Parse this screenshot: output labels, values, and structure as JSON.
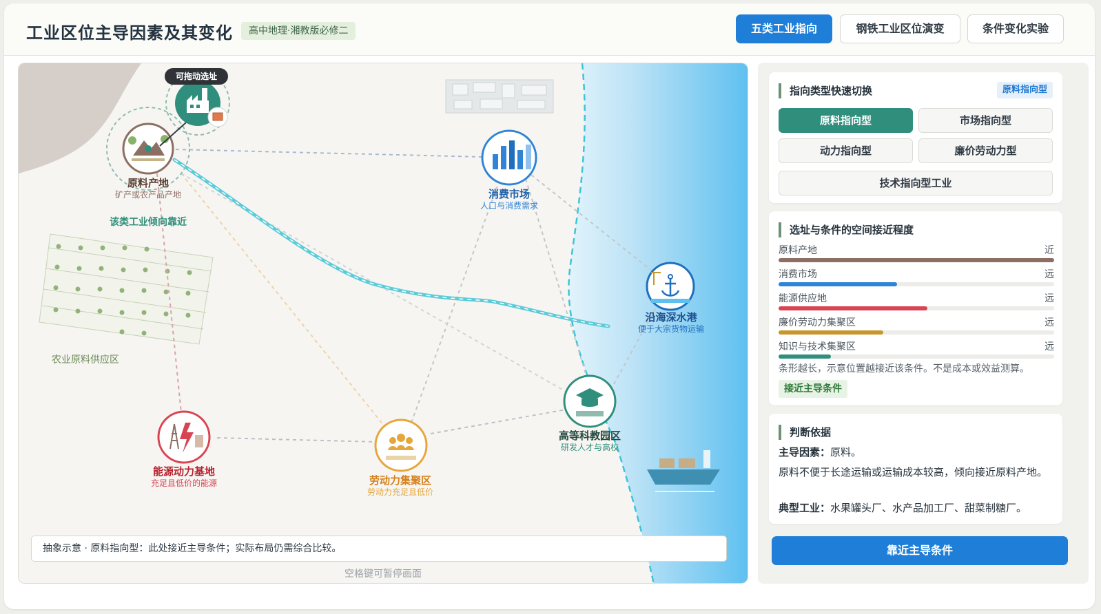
{
  "header": {
    "title": "工业区位主导因素及其变化",
    "subtitle": "高中地理·湘教版必修二",
    "tabs": [
      {
        "label": "五类工业指向",
        "active": true
      },
      {
        "label": "钢铁工业区位演变",
        "active": false
      },
      {
        "label": "条件变化实验",
        "active": false
      }
    ]
  },
  "map": {
    "drag_tip": "可拖动选址",
    "nodes": {
      "raw": {
        "name": "原料产地",
        "desc": "矿产或农产品产地"
      },
      "market": {
        "name": "消费市场",
        "desc": "人口与消费需求"
      },
      "port": {
        "name": "沿海深水港",
        "desc": "便于大宗货物运输"
      },
      "tech": {
        "name": "高等科教园区",
        "desc": "研发人才与高校"
      },
      "energy": {
        "name": "能源动力基地",
        "desc": "充足且低价的能源"
      },
      "labor": {
        "name": "劳动力集聚区",
        "desc": "劳动力充足且低价"
      }
    },
    "tendency_label": "该类工业倾向靠近",
    "farm_label": "农业原料供应区",
    "caption": "抽象示意 · 原料指向型：此处接近主导条件；实际布局仍需综合比较。",
    "hint": "空格键可暂停画面"
  },
  "sidebar": {
    "switch_card": {
      "title": "指向类型快速切换",
      "current_badge": "原料指向型",
      "types": [
        {
          "label": "原料指向型",
          "active": true
        },
        {
          "label": "市场指向型",
          "active": false
        },
        {
          "label": "动力指向型",
          "active": false
        },
        {
          "label": "廉价劳动力型",
          "active": false
        },
        {
          "label": "技术指向型工业",
          "active": false
        }
      ]
    },
    "proximity_card": {
      "title": "选址与条件的空间接近程度",
      "rows": [
        {
          "label": "原料产地",
          "value": "近",
          "fill": 1.0,
          "color": "#8c6f62"
        },
        {
          "label": "消费市场",
          "value": "远",
          "fill": 0.43,
          "color": "#2f84d6"
        },
        {
          "label": "能源供应地",
          "value": "远",
          "fill": 0.54,
          "color": "#d94452"
        },
        {
          "label": "廉价劳动力集聚区",
          "value": "远",
          "fill": 0.38,
          "color": "#c9962e"
        },
        {
          "label": "知识与技术集聚区",
          "value": "远",
          "fill": 0.19,
          "color": "#2f8f7c"
        }
      ],
      "note": "条形越长，示意位置越接近该条件。不是成本或效益测算。",
      "badge": "接近主导条件"
    },
    "basis_card": {
      "title": "判断依据",
      "factor_label": "主导因素：",
      "factor_value": "原料。",
      "reason": "原料不便于长途运输或运输成本较高，倾向接近原料产地。",
      "typical_label": "典型工业：",
      "typical_value": "水果罐头厂、水产品加工厂、甜菜制糖厂。"
    },
    "action_button": "靠近主导条件"
  }
}
